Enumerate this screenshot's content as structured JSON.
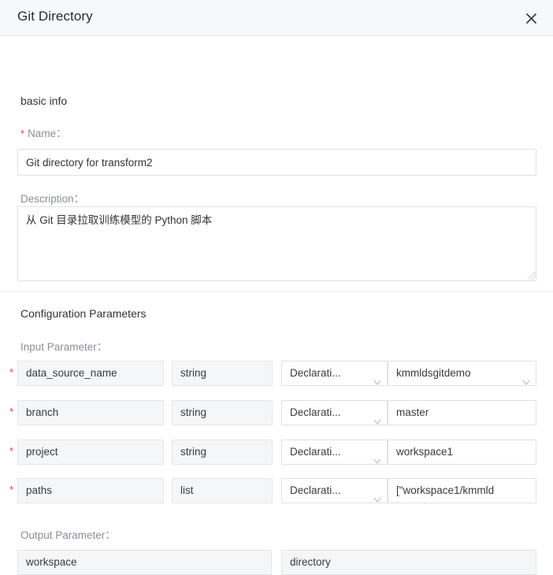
{
  "dialog": {
    "title": "Git Directory",
    "close_icon": "close-icon"
  },
  "basic_info": {
    "section_label": "basic info",
    "name": {
      "required_mark": "*",
      "label": "Name：",
      "value": "Git directory for transform2",
      "placeholder": ""
    },
    "description": {
      "label": "Description：",
      "value": "从 Git 目录拉取训练模型的 Python 脚本",
      "placeholder": ""
    }
  },
  "configuration": {
    "section_label": "Configuration Parameters",
    "input_label": "Input Parameter：",
    "output_label": "Output Parameter：",
    "input_rows": [
      {
        "required_mark": "*",
        "name": "data_source_name",
        "type": "string",
        "source": "Declarati...",
        "value": "kmmldsgitdemo",
        "value_is_select": true
      },
      {
        "required_mark": "*",
        "name": "branch",
        "type": "string",
        "source": "Declarati...",
        "value": "master",
        "value_is_select": false
      },
      {
        "required_mark": "*",
        "name": "project",
        "type": "string",
        "source": "Declarati...",
        "value": "workspace1",
        "value_is_select": false
      },
      {
        "required_mark": "*",
        "name": "paths",
        "type": "list",
        "source": "Declarati...",
        "value": "[\"workspace1/kmmld",
        "value_is_select": false
      }
    ],
    "output_rows": [
      {
        "name": "workspace",
        "type": "directory"
      }
    ]
  },
  "colors": {
    "header_bg": "#f7f8fa",
    "border": "#dfe1e6",
    "field_gray": "#f5f6f8",
    "required_red": "#e13f3f",
    "label_gray": "#8a8e99",
    "text": "#333333"
  }
}
